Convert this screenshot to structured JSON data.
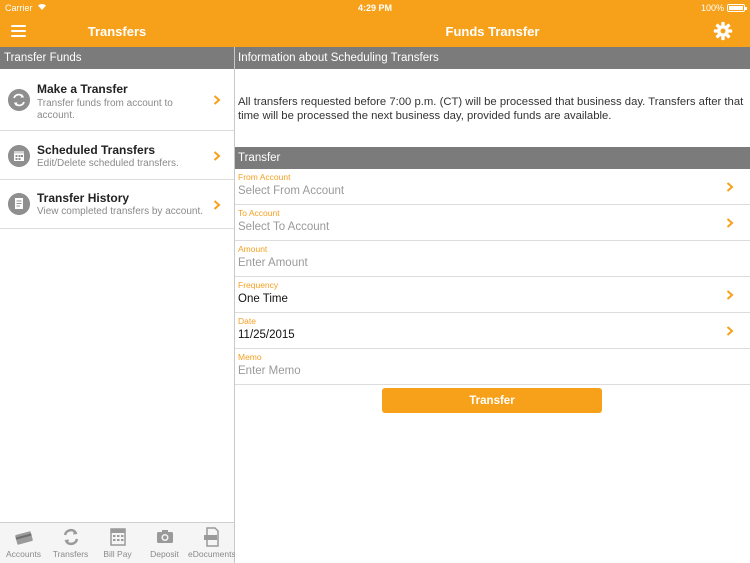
{
  "status_bar": {
    "carrier": "Carrier",
    "time": "4:29 PM",
    "battery": "100%"
  },
  "left_nav": {
    "title": "Transfers"
  },
  "right_nav": {
    "title": "Funds Transfer"
  },
  "left_panel": {
    "section_header": "Transfer Funds",
    "items": [
      {
        "title": "Make a Transfer",
        "subtitle": "Transfer funds from account to account.",
        "icon": "transfer-arrows-icon"
      },
      {
        "title": "Scheduled Transfers",
        "subtitle": "Edit/Delete scheduled transfers.",
        "icon": "calendar-icon"
      },
      {
        "title": "Transfer History",
        "subtitle": "View completed transfers by account.",
        "icon": "document-icon"
      }
    ]
  },
  "tabbar": {
    "tabs": [
      {
        "label": "Accounts",
        "icon": "card-icon"
      },
      {
        "label": "Transfers",
        "icon": "transfer-icon"
      },
      {
        "label": "Bill Pay",
        "icon": "calendar-icon"
      },
      {
        "label": "Deposit",
        "icon": "camera-icon"
      },
      {
        "label": "eDocuments",
        "icon": "pdf-document-icon"
      }
    ]
  },
  "right_panel": {
    "info_header": "Information about Scheduling Transfers",
    "info_text": "All transfers requested before 7:00 p.m. (CT) will be processed that business day. Transfers after that time will be processed the next business day, provided funds are available.",
    "transfer_header": "Transfer",
    "fields": [
      {
        "label": "From Account",
        "value": "Select From Account",
        "filled": false,
        "chevron": true
      },
      {
        "label": "To Account",
        "value": "Select To Account",
        "filled": false,
        "chevron": true
      },
      {
        "label": "Amount",
        "value": "Enter Amount",
        "filled": false,
        "chevron": false
      },
      {
        "label": "Frequency",
        "value": "One Time",
        "filled": true,
        "chevron": true
      },
      {
        "label": "Date",
        "value": "11/25/2015",
        "filled": true,
        "chevron": true
      },
      {
        "label": "Memo",
        "value": "Enter Memo",
        "filled": false,
        "chevron": false
      }
    ],
    "submit_label": "Transfer"
  },
  "colors": {
    "accent": "#f7a11a",
    "section_header": "#7b7b7b",
    "field_label": "#f5a020"
  }
}
